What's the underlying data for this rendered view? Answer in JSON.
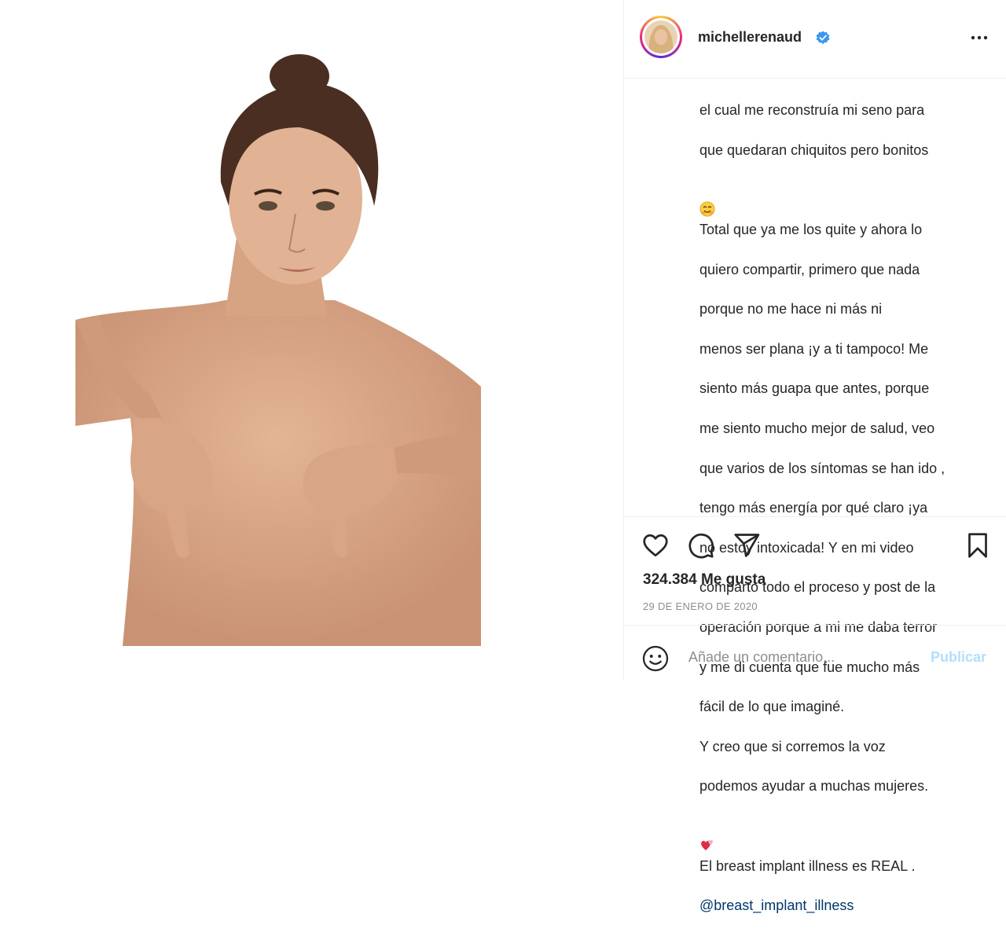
{
  "post": {
    "username": "michellerenaud",
    "verified": true,
    "caption_lines": [
      "el cual me reconstruía mi seno para",
      "que quedaran chiquitos pero bonitos",
      "",
      "Total que ya me los quite y ahora lo",
      "quiero compartir, primero que nada",
      "porque no me hace ni más ni",
      "menos ser plana ¡y a ti tampoco! Me",
      "siento más guapa que antes, porque",
      "me siento mucho mejor de salud, veo",
      "que varios de los síntomas se han ido ,",
      "tengo más energía por qué claro ¡ya",
      "no estoy intoxicada! Y en mi video",
      "comparto todo el proceso y post de la",
      "operación porque a mi me daba terror",
      "y me di cuenta que fue mucho más",
      "fácil de lo que imaginé.",
      "Y creo que si corremos la voz",
      "podemos ayudar a muchas mujeres.",
      "",
      "El breast implant illness es REAL ."
    ],
    "mention": "@breast_implant_illness",
    "likes": "324.384 Me gusta",
    "date": "29 DE ENERO DE 2020",
    "comment_placeholder": "Añade un comentario...",
    "publish_label": "Publicar"
  },
  "icons": {
    "more": "more-options-icon",
    "verified": "verified-badge-icon",
    "like": "heart-icon",
    "comment": "comment-icon",
    "share": "share-icon",
    "save": "bookmark-icon",
    "emoji": "smiley-icon"
  },
  "colors": {
    "verified": "#3897f0",
    "mention": "#00376b",
    "publish": "#b2dffc",
    "muted": "#8e8e8e"
  }
}
